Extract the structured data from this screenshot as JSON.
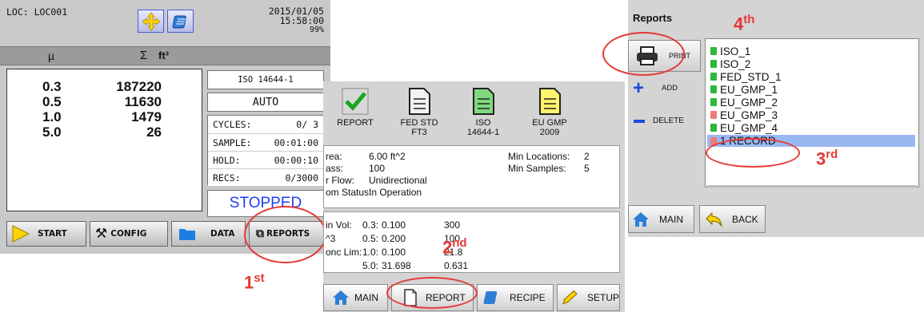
{
  "panel1": {
    "location": "LOC:  LOC001",
    "date": "2015/01/05",
    "time": "15:58:00",
    "battery_pct": "99%",
    "col_size": "µ",
    "col_sum": "Σ",
    "col_unit": "ft³",
    "counts": [
      {
        "size": "0.3",
        "count": "187220"
      },
      {
        "size": "0.5",
        "count": "11630"
      },
      {
        "size": "1.0",
        "count": "1479"
      },
      {
        "size": "5.0",
        "count": "26"
      }
    ],
    "standard": "ISO 14644-1",
    "mode": "AUTO",
    "stats": [
      {
        "label": "CYCLES:",
        "value": "0/   3"
      },
      {
        "label": "SAMPLE:",
        "value": "00:01:00"
      },
      {
        "label": "HOLD:",
        "value": "00:00:10"
      },
      {
        "label": "RECS:",
        "value": "0/3000"
      }
    ],
    "status": "STOPPED",
    "buttons": {
      "start": "START",
      "config": "CONFIG",
      "data": "DATA",
      "reports": "REPORTS"
    },
    "step": "1",
    "step_suffix": "st"
  },
  "panel2": {
    "tabs": [
      {
        "label": "REPORT",
        "sub": ""
      },
      {
        "label": "FED STD",
        "sub": "FT3"
      },
      {
        "label": "ISO",
        "sub": "14644-1"
      },
      {
        "label": "EU GMP",
        "sub": "2009"
      }
    ],
    "info_left": [
      {
        "label": "rea:",
        "value": "6.00  ft^2"
      },
      {
        "label": "ass:",
        "value": "100"
      },
      {
        "label": "r Flow:",
        "value": "Unidirectional"
      },
      {
        "label": "om Status:",
        "value": "In Operation"
      }
    ],
    "info_right": [
      {
        "label": "Min Locations:",
        "value": "2"
      },
      {
        "label": "Min Samples:",
        "value": "5"
      }
    ],
    "limits_labels": [
      "in Vol:",
      "^3",
      "onc Lim:"
    ],
    "limits_rows": [
      {
        "size": "0.3:",
        "vol": "0.100",
        "lim": "300"
      },
      {
        "size": "0.5:",
        "vol": "0.200",
        "lim": "100"
      },
      {
        "size": "1.0:",
        "vol": "0.100",
        "lim": "21.8"
      },
      {
        "size": "5.0:",
        "vol": "31.698",
        "lim": "0.631"
      }
    ],
    "buttons": {
      "main": "MAIN",
      "report": "REPORT",
      "recipe": "RECIPE",
      "setup": "SETUP"
    },
    "step": "2",
    "step_suffix": "nd"
  },
  "panel3": {
    "title": "Reports",
    "buttons": {
      "print": "PRINT",
      "add": "ADD",
      "delete": "DELETE",
      "main": "MAIN",
      "back": "BACK"
    },
    "items": [
      "ISO_1",
      "ISO_2",
      "FED_STD_1",
      "EU_GMP_1",
      "EU_GMP_2",
      "EU_GMP_3",
      "EU_GMP_4",
      "1 RECORD"
    ],
    "step3": "3",
    "step3_suffix": "rd",
    "step4": "4",
    "step4_suffix": "th"
  },
  "colors": {
    "accent_red": "#e53935",
    "status_blue": "#1e3df2",
    "selection": "#9ab8f0"
  }
}
